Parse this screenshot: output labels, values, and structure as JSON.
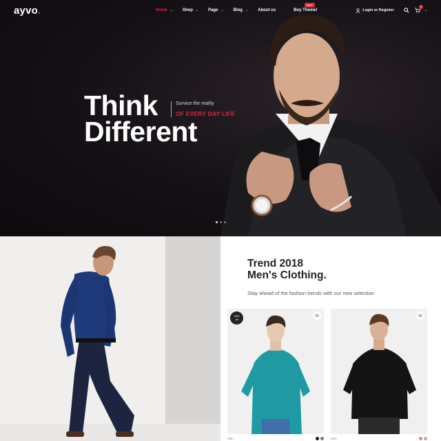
{
  "brand": {
    "name": "ayvo",
    "accent": "#e3263a"
  },
  "nav": {
    "items": [
      {
        "label": "Home",
        "active": true,
        "has_dropdown": true
      },
      {
        "label": "Shop",
        "has_dropdown": true
      },
      {
        "label": "Page",
        "has_dropdown": true
      },
      {
        "label": "Blog",
        "has_dropdown": true
      },
      {
        "label": "About us",
        "has_dropdown": false
      },
      {
        "label": "Buy Theme!",
        "has_dropdown": false,
        "badge": "HOT"
      }
    ]
  },
  "header": {
    "login_label": "Login or Register",
    "cart_count": "0",
    "icons": [
      "user-icon",
      "search-icon",
      "cart-icon"
    ]
  },
  "hero": {
    "headline_line1": "Think",
    "headline_line2": "Different",
    "tagline_sub": "Survice the reality",
    "tagline_main": "OF EVERY DAY LIFE"
  },
  "promo": {
    "title_line1": "Trend 2018",
    "title_line2": "Men's Clothing.",
    "subtitle": "Stay ahead of the fashion trends with our new selection"
  },
  "products": [
    {
      "discount_line1": "45%",
      "discount_line2": "off",
      "shirt_color": "#1f9aa3",
      "category": "Men",
      "swatches": [
        "#111111",
        "#7a7a6a"
      ]
    },
    {
      "shirt_color": "#141414",
      "category": "Men",
      "swatches": [
        "#e08a6a",
        "#b0b0b0"
      ]
    }
  ]
}
